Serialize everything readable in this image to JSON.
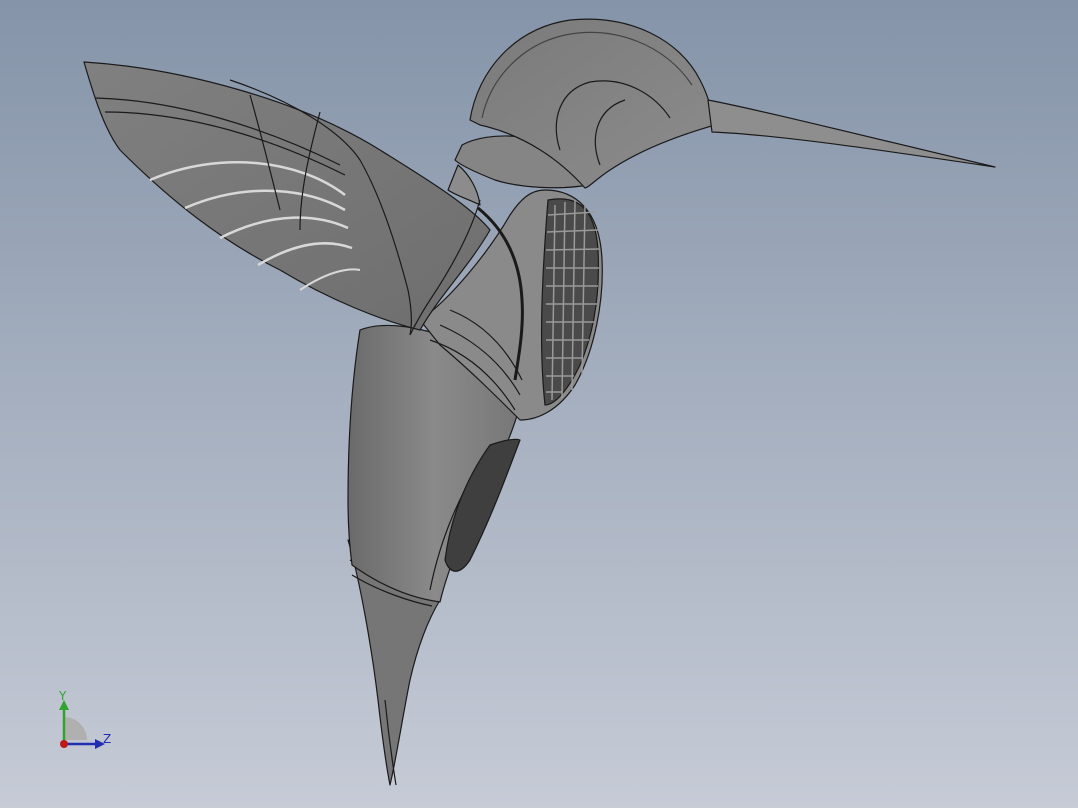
{
  "viewport": {
    "background_top": "#8594a9",
    "background_bottom": "#c6cbd6"
  },
  "model": {
    "icon": "hummingbird-model",
    "shade_color": "#7d7d7d",
    "edge_color": "#1a1a1a"
  },
  "triad": {
    "y_label": "Y",
    "z_label": "Z",
    "y_color": "#2fa52f",
    "z_color": "#1f2fb0",
    "origin_color": "#c0191a"
  }
}
